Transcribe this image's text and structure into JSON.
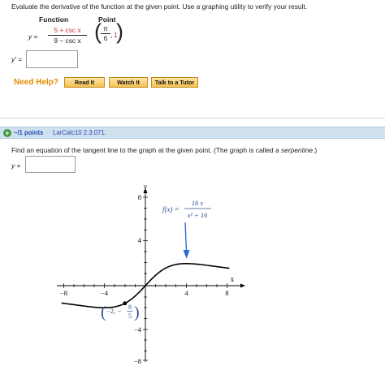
{
  "question1": {
    "instructions": "Evaluate the derivative of the function at the given point. Use a graphing utility to verify your result.",
    "function_header": "Function",
    "point_header": "Point",
    "y_label": "y =",
    "numerator": "5 + csc x",
    "denominator": "9 − csc x",
    "point_x_num": "π",
    "point_x_den": "6",
    "point_comma": ",",
    "point_y": "1",
    "answer_label": "y′ =",
    "answer_value": "",
    "need_help": "Need Help?",
    "buttons": {
      "read": "Read It",
      "watch": "Watch It",
      "tutor": "Talk to a Tutor"
    }
  },
  "question2": {
    "points": "–/1 points",
    "code": "LarCalc10 2.3.071.",
    "instructions_main": "Find an equation of the tangent line to the graph at the given point. (The graph is called a ",
    "instructions_italic": "serpentine",
    "instructions_end": ".)",
    "answer_label": "y =",
    "answer_value": ""
  },
  "graph": {
    "y_axis_label": "y",
    "x_axis_label": "x",
    "x_ticks": [
      "−8",
      "−4",
      "4",
      "8"
    ],
    "y_ticks": [
      "8",
      "4",
      "−4",
      "−8"
    ],
    "f_label": "f(x) =",
    "f_num": "16 x",
    "f_den": "x² + 16",
    "point_label_prefix": "−2,  −",
    "point_label_num": "8",
    "point_label_den": "5",
    "point_x": -2,
    "point_y": -1.6,
    "x_range": [
      -8.8,
      8.8
    ],
    "y_range": [
      -8.5,
      8.5
    ],
    "colors": {
      "curve": "#000000",
      "arrow": "#2a6fd6",
      "label": "#2f4f8f"
    }
  }
}
